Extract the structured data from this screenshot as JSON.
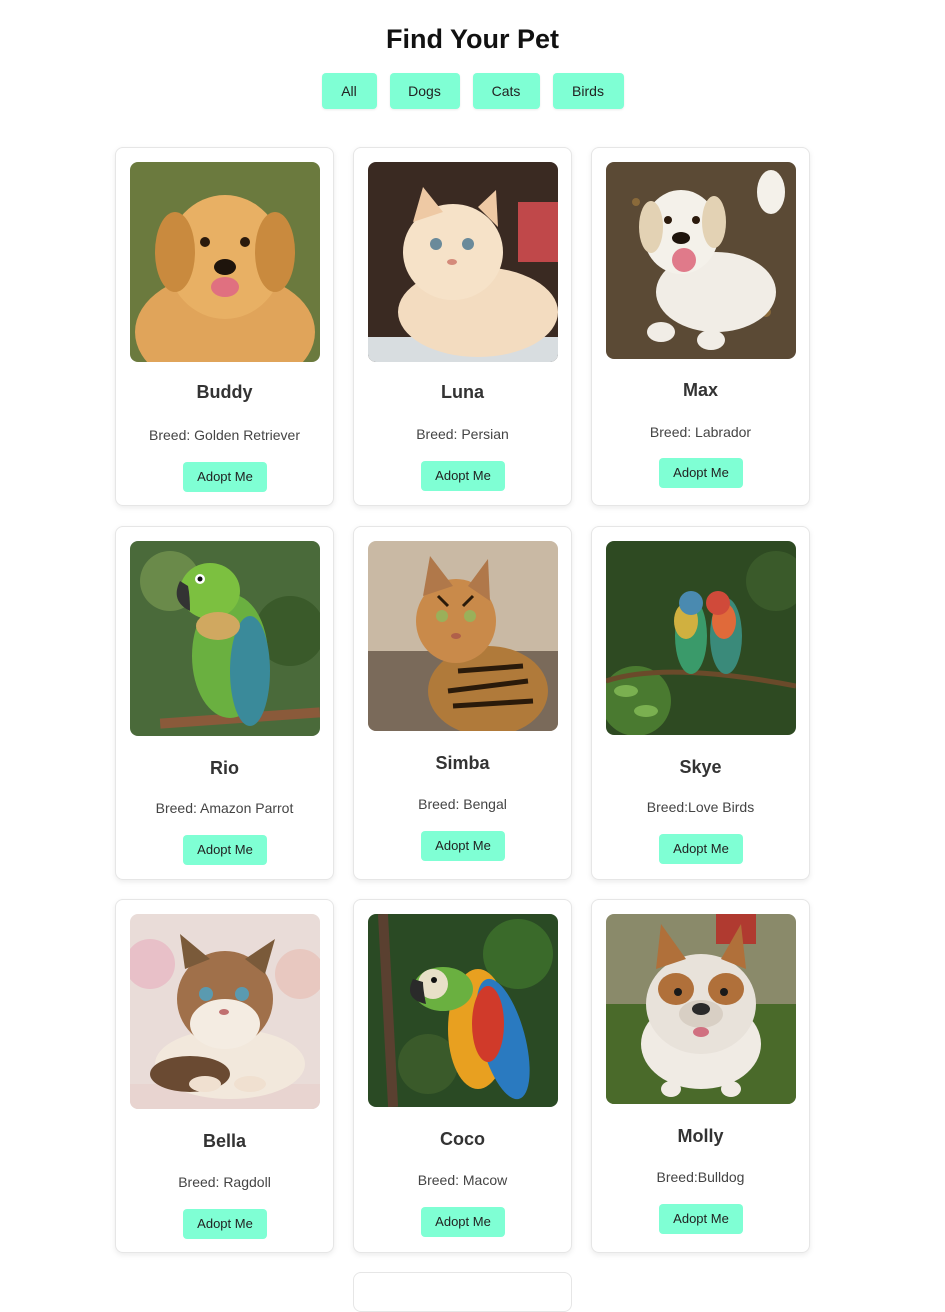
{
  "page": {
    "title": "Find Your Pet"
  },
  "filters": [
    {
      "label": "All"
    },
    {
      "label": "Dogs"
    },
    {
      "label": "Cats"
    },
    {
      "label": "Birds"
    }
  ],
  "pets": [
    {
      "name": "Buddy",
      "breed": "Breed: Golden Retriever",
      "button": "Adopt Me",
      "photo_icon": "golden-retriever-photo"
    },
    {
      "name": "Luna",
      "breed": "Breed: Persian",
      "button": "Adopt Me",
      "photo_icon": "persian-cat-photo"
    },
    {
      "name": "Max",
      "breed": "Breed: Labrador",
      "button": "Adopt Me",
      "photo_icon": "labrador-photo"
    },
    {
      "name": "Rio",
      "breed": "Breed: Amazon Parrot",
      "button": "Adopt Me",
      "photo_icon": "amazon-parrot-photo"
    },
    {
      "name": "Simba",
      "breed": "Breed: Bengal",
      "button": "Adopt Me",
      "photo_icon": "bengal-cat-photo"
    },
    {
      "name": "Skye",
      "breed": "Breed:Love Birds",
      "button": "Adopt Me",
      "photo_icon": "love-birds-photo"
    },
    {
      "name": "Bella",
      "breed": "Breed: Ragdoll",
      "button": "Adopt Me",
      "photo_icon": "ragdoll-cat-photo"
    },
    {
      "name": "Coco",
      "breed": "Breed: Macow",
      "button": "Adopt Me",
      "photo_icon": "macaw-photo"
    },
    {
      "name": "Molly",
      "breed": "Breed:Bulldog",
      "button": "Adopt Me",
      "photo_icon": "bulldog-photo"
    }
  ],
  "colors": {
    "accent": "#7fffd4",
    "card_border": "#e6e6e6",
    "title": "#111111"
  }
}
